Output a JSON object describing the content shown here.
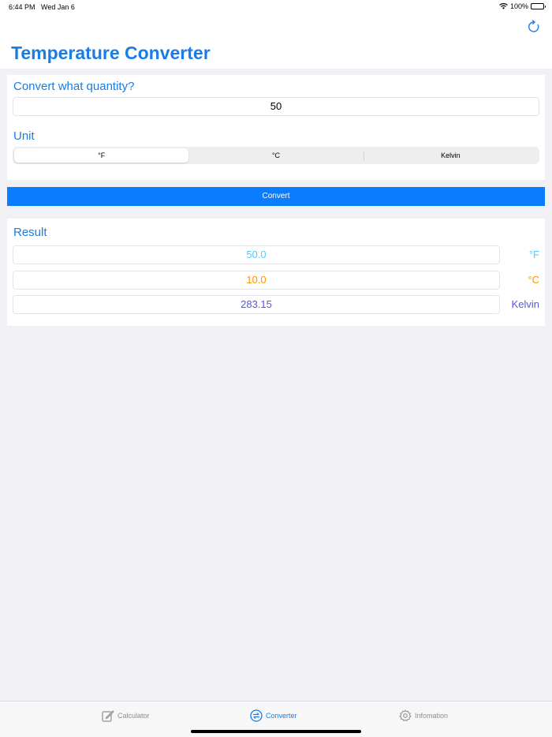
{
  "status": {
    "time": "6:44 PM",
    "date": "Wed Jan 6",
    "battery": "100%"
  },
  "header": {
    "title": "Temperature Converter",
    "refresh_icon": "refresh-icon"
  },
  "input": {
    "quantity_label": "Convert what quantity?",
    "quantity_value": "50",
    "unit_label": "Unit",
    "units": [
      "°F",
      "°C",
      "Kelvin"
    ],
    "selected_unit": "°F"
  },
  "convert_button": "Convert",
  "result": {
    "label": "Result",
    "rows": [
      {
        "value": "50.0",
        "unit": "°F",
        "color": "#5ac8fa"
      },
      {
        "value": "10.0",
        "unit": "°C",
        "color": "#ff9500"
      },
      {
        "value": "283.15",
        "unit": "Kelvin",
        "color": "#5856d6"
      }
    ]
  },
  "tabs": [
    {
      "label": "Calculator",
      "icon": "pencil-square-icon",
      "active": false
    },
    {
      "label": "Converter",
      "icon": "arrows-circle-icon",
      "active": true
    },
    {
      "label": "Infomation",
      "icon": "gear-icon",
      "active": false
    }
  ],
  "colors": {
    "accent": "#1a7ce6",
    "button": "#0a7cff",
    "background": "#f0f0f5"
  }
}
